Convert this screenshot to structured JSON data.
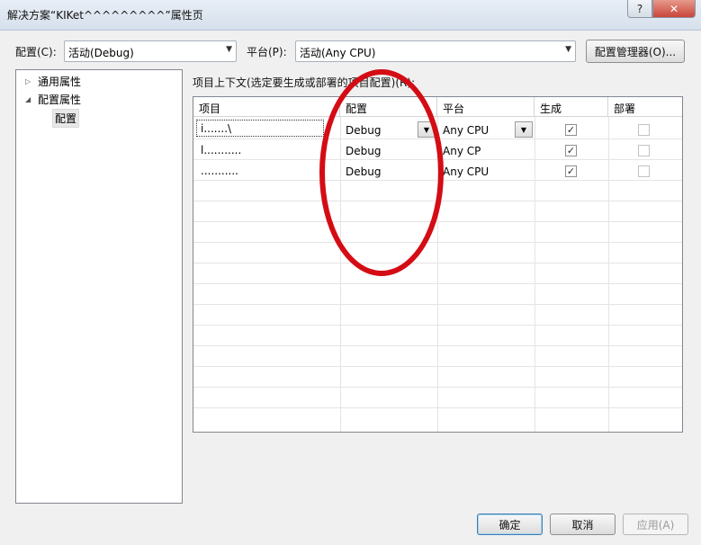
{
  "window": {
    "title": "解决方案“KIKet^^^^^^^^^”属性页",
    "help_label": "?",
    "close_label": "✕"
  },
  "toolbar": {
    "config_label": "配置(C):",
    "config_value": "活动(Debug)",
    "platform_label": "平台(P):",
    "platform_value": "活动(Any CPU)",
    "config_manager_label": "配置管理器(O)..."
  },
  "tree": {
    "items": [
      {
        "label": "通用属性",
        "expander": "▷"
      },
      {
        "label": "配置属性",
        "expander": "◢"
      },
      {
        "label": "配置",
        "expander": ""
      }
    ]
  },
  "grid": {
    "caption": "项目上下文(选定要生成或部署的项目配置)(R):",
    "columns": [
      "项目",
      "配置",
      "平台",
      "生成",
      "部署"
    ],
    "rows": [
      {
        "project": "i.......\\",
        "config": "Debug",
        "platform": "Any CPU",
        "build": true,
        "deploy": false
      },
      {
        "project": "l...........",
        "config": "Debug",
        "platform": "Any CP",
        "build": true,
        "deploy": false
      },
      {
        "project": "...........",
        "config": "Debug",
        "platform": "Any CPU",
        "build": true,
        "deploy": false
      }
    ]
  },
  "buttons": {
    "ok": "确定",
    "cancel": "取消",
    "apply": "应用(A)"
  },
  "icons": {
    "dropdown": "▼",
    "check": "✓"
  },
  "colors": {
    "annotation_oval": "#d40c14"
  }
}
